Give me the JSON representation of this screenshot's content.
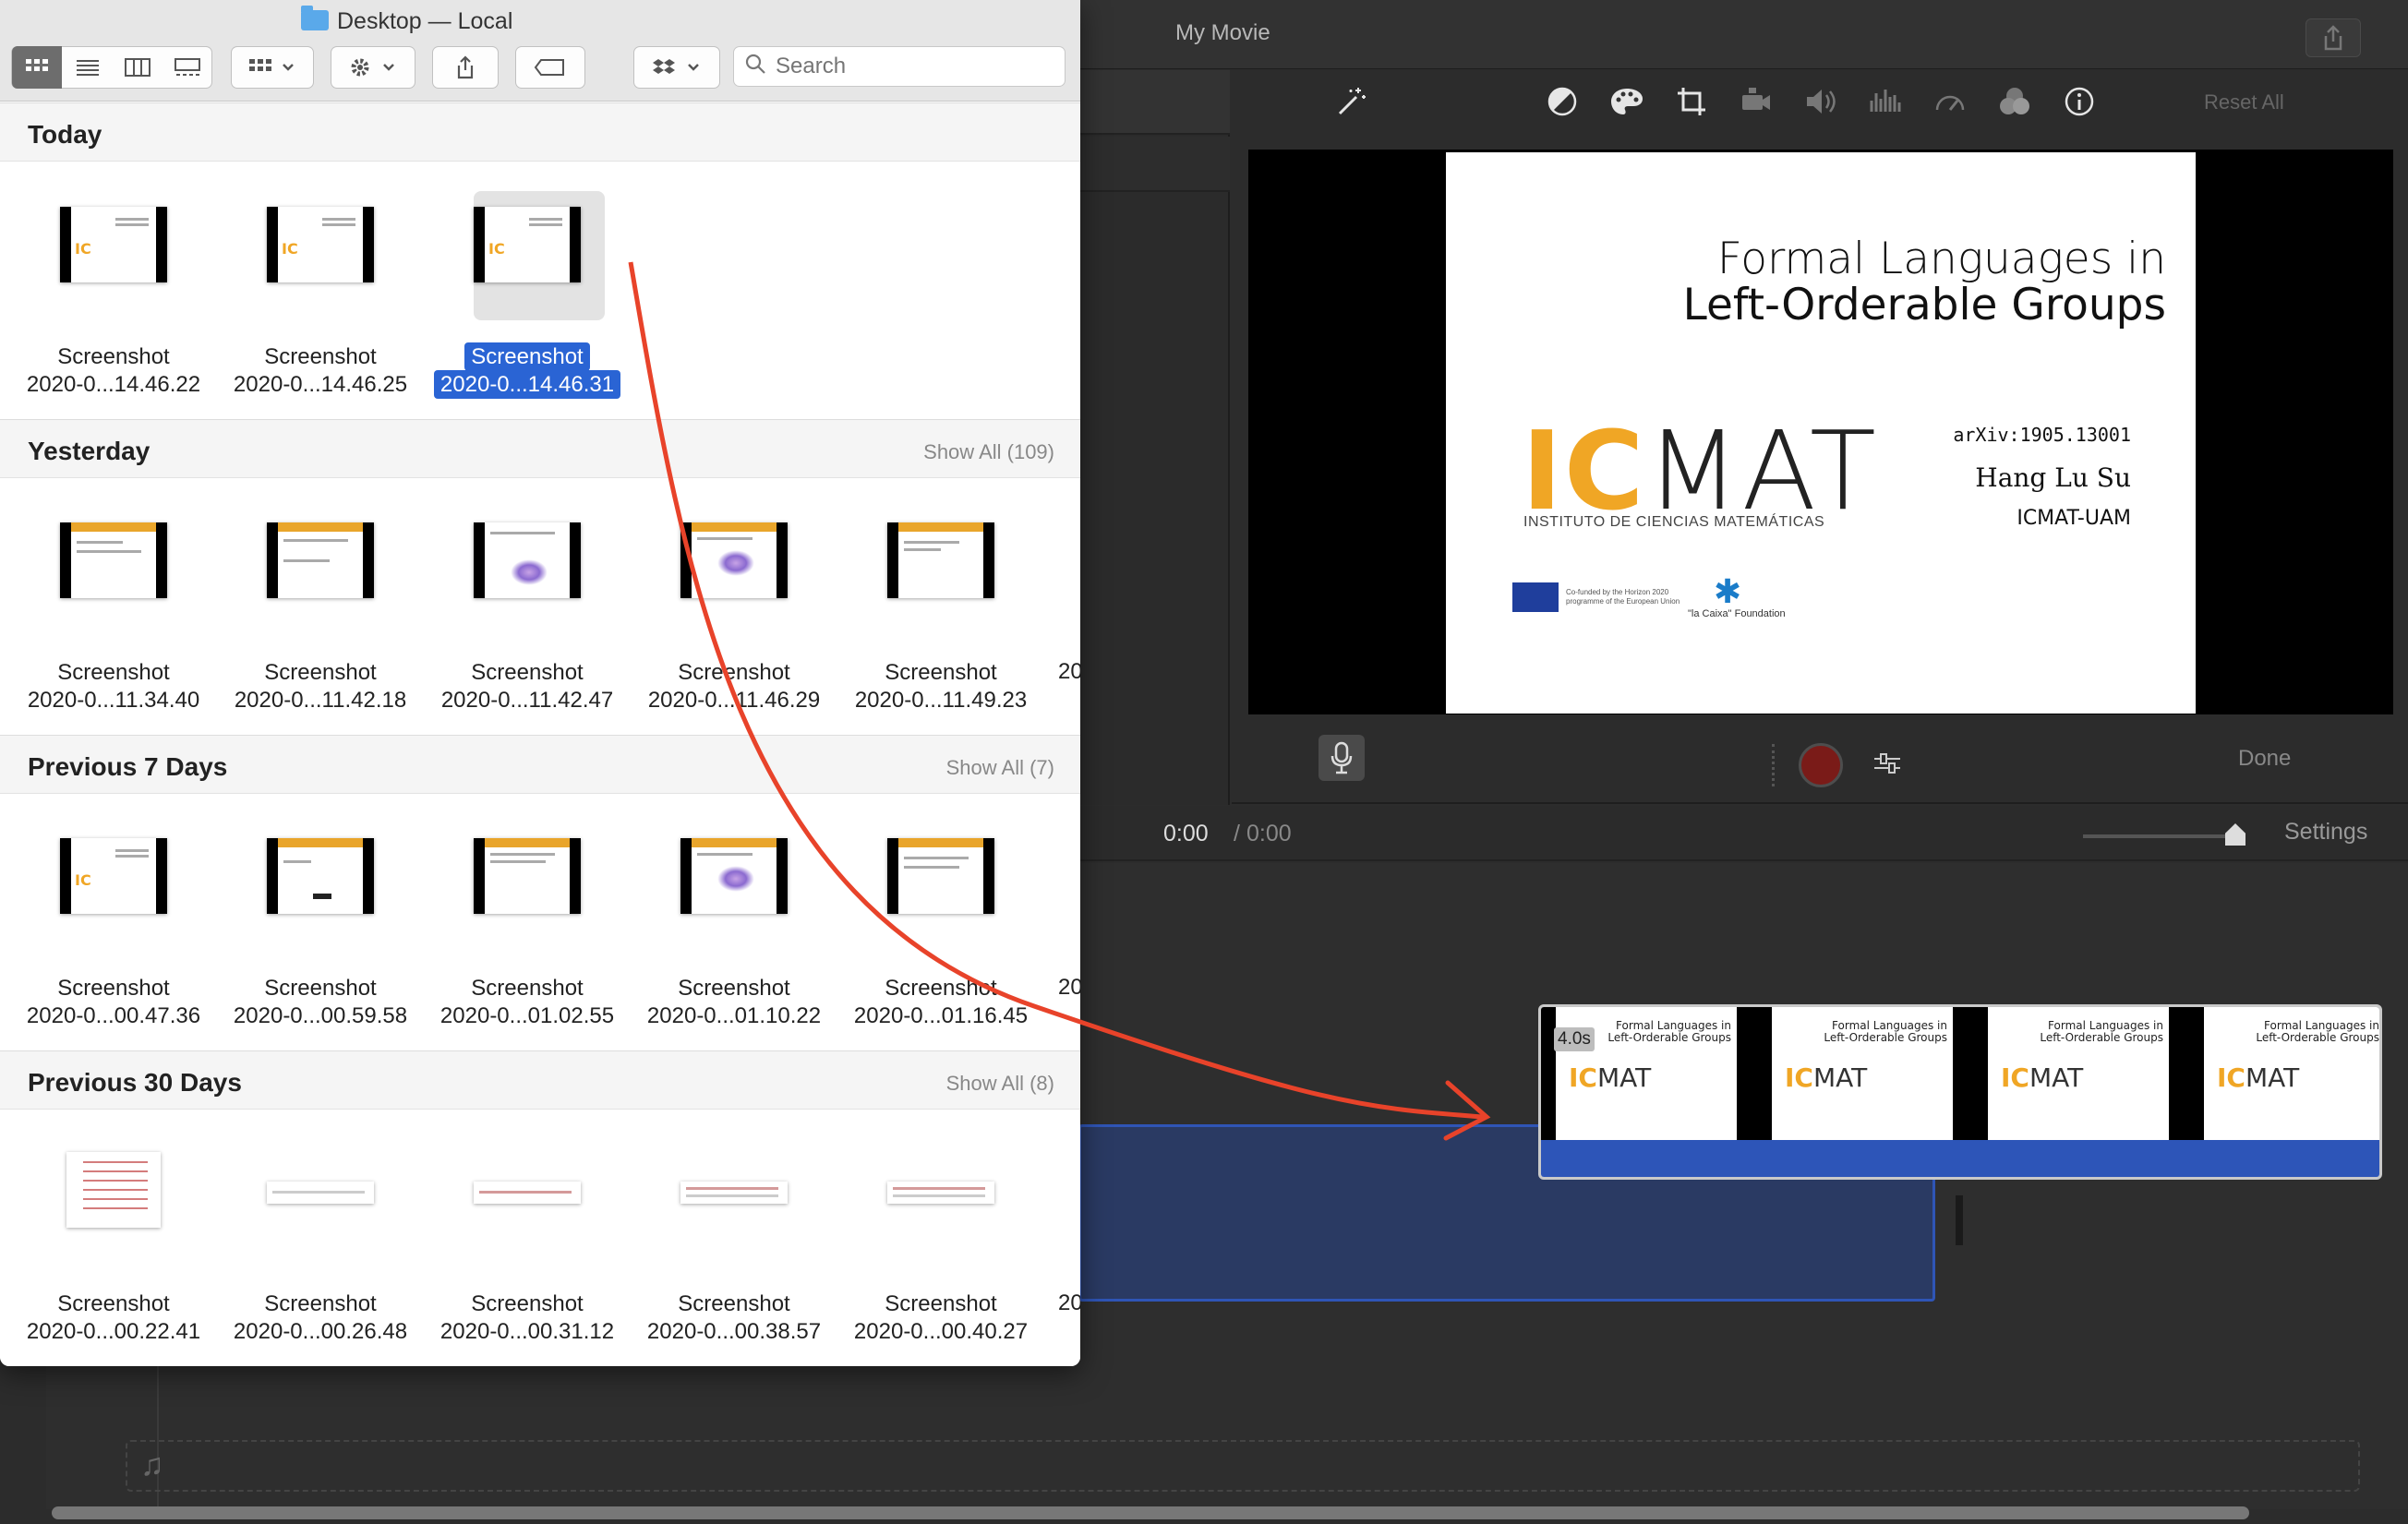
{
  "imovie": {
    "title": "My Movie",
    "reset_all": "Reset All",
    "done": "Done",
    "time_current": "0:00",
    "time_separator": "/",
    "time_total": "0:00",
    "settings": "Settings",
    "clip_duration": "4.0s",
    "toolbar_icons": [
      "magic-wand-icon",
      "color-balance-icon",
      "color-correction-icon",
      "crop-icon",
      "stabilization-icon",
      "volume-icon",
      "noise-reduction-icon",
      "speed-icon",
      "clip-filter-icon",
      "info-icon"
    ],
    "slide": {
      "title_line1": "Formal Languages in",
      "title_line2": "Left-Orderable Groups",
      "logo_ic": "IC",
      "logo_mat": "MAT",
      "institute": "INSTITUTO DE CIENCIAS MATEMÁTICAS",
      "arxiv": "arXiv:1905.13001",
      "author": "Hang Lu Su",
      "affiliation": "ICMAT-UAM",
      "eu_note": "Co-funded by the Horizon 2020 programme of the European Union",
      "foundation": "\"la Caixa\" Foundation"
    },
    "clip_frame": {
      "title_line1": "Formal Languages in",
      "title_line2": "Left-Orderable Groups"
    }
  },
  "finder": {
    "title": "Desktop — Local",
    "search_placeholder": "Search",
    "sections": [
      {
        "title": "Today",
        "show_all": "",
        "items": [
          {
            "name": "Screenshot",
            "date": "2020-0...14.46.22"
          },
          {
            "name": "Screenshot",
            "date": "2020-0...14.46.25"
          },
          {
            "name": "Screenshot",
            "date": "2020-0...14.46.31",
            "selected": true
          }
        ]
      },
      {
        "title": "Yesterday",
        "show_all": "Show All (109)",
        "items": [
          {
            "name": "Screenshot",
            "date": "2020-0...11.34.40"
          },
          {
            "name": "Screenshot",
            "date": "2020-0...11.42.18"
          },
          {
            "name": "Screenshot",
            "date": "2020-0...11.42.47"
          },
          {
            "name": "Screenshot",
            "date": "2020-0...11.46.29"
          },
          {
            "name": "Screenshot",
            "date": "2020-0...11.49.23"
          }
        ],
        "cut_label": "20"
      },
      {
        "title": "Previous 7 Days",
        "show_all": "Show All (7)",
        "items": [
          {
            "name": "Screenshot",
            "date": "2020-0...00.47.36"
          },
          {
            "name": "Screenshot",
            "date": "2020-0...00.59.58"
          },
          {
            "name": "Screenshot",
            "date": "2020-0...01.02.55"
          },
          {
            "name": "Screenshot",
            "date": "2020-0...01.10.22"
          },
          {
            "name": "Screenshot",
            "date": "2020-0...01.16.45"
          }
        ],
        "cut_label": "20"
      },
      {
        "title": "Previous 30 Days",
        "show_all": "Show All (8)",
        "items": [
          {
            "name": "Screenshot",
            "date": "2020-0...00.22.41"
          },
          {
            "name": "Screenshot",
            "date": "2020-0...00.26.48"
          },
          {
            "name": "Screenshot",
            "date": "2020-0...00.31.12"
          },
          {
            "name": "Screenshot",
            "date": "2020-0...00.38.57"
          },
          {
            "name": "Screenshot",
            "date": "2020-0...00.40.27"
          }
        ],
        "cut_label": "20"
      }
    ]
  },
  "colors": {
    "selection": "#2a64d4",
    "annotation_arrow": "#e8432a",
    "clip_blue": "#2d55b8",
    "icmat_orange": "#f0a625"
  }
}
